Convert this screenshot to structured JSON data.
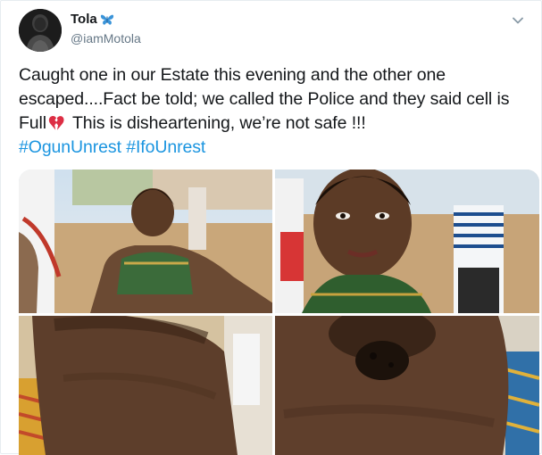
{
  "tweet": {
    "author": {
      "display_name": "Tola",
      "badge_icon": "butterfly-icon",
      "handle": "@iamMotola"
    },
    "menu_icon": "chevron-down-icon",
    "text_part1": "Caught one in our Estate this evening and the other one escaped....Fact be told; we called the Police and they said cell is Full",
    "emoji": "broken-heart-icon",
    "text_part2": " This is disheartening, we’re not safe !!!",
    "hashtags": [
      "#OgunUnrest",
      "#IfoUnrest"
    ],
    "media": [
      {
        "name": "photo-1",
        "icon": "photo-icon"
      },
      {
        "name": "photo-2",
        "icon": "photo-icon"
      },
      {
        "name": "photo-3",
        "icon": "photo-icon"
      },
      {
        "name": "photo-4",
        "icon": "photo-icon"
      }
    ],
    "colors": {
      "link": "#1b95e0",
      "text": "#14171a",
      "secondary": "#657786",
      "heart": "#e0245e"
    }
  }
}
